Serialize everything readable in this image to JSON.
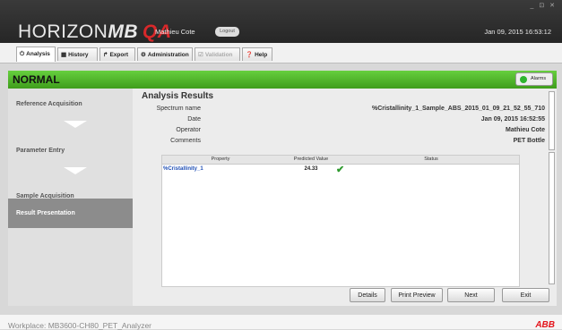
{
  "app": {
    "logo_horizon": "HORIZON",
    "logo_mb": "MB",
    "logo_qa": "QA",
    "user": "Mathieu Cote",
    "logout_label": "Logout",
    "datetime": "Jan 09, 2015 16:53:12",
    "window_controls": "_ ⊡ ✕"
  },
  "tabs": [
    {
      "label": "Analysis",
      "icon": "analysis-icon",
      "active": true
    },
    {
      "label": "History",
      "icon": "history-icon"
    },
    {
      "label": "Export",
      "icon": "export-icon"
    },
    {
      "label": "Administration",
      "icon": "administration-icon"
    },
    {
      "label": "Validation",
      "icon": "validation-icon",
      "disabled": true
    },
    {
      "label": "Help",
      "icon": "help-icon"
    }
  ],
  "status": {
    "text": "NORMAL",
    "color": "#4caf2b",
    "alarms_label": "Alarms"
  },
  "steps": [
    {
      "label": "Reference Acquisition"
    },
    {
      "label": "Parameter Entry"
    },
    {
      "label": "Sample Acquisition"
    },
    {
      "label": "Result Presentation",
      "active": true
    }
  ],
  "results": {
    "title": "Analysis Results",
    "fields": [
      {
        "label": "Spectrum name",
        "value": "%Cristallinity_1_Sample_ABS_2015_01_09_21_52_55_710"
      },
      {
        "label": "Date",
        "value": "Jan 09, 2015 16:52:55"
      },
      {
        "label": "Operator",
        "value": "Mathieu Cote"
      },
      {
        "label": "Comments",
        "value": "PET Bottle"
      }
    ]
  },
  "table": {
    "columns": [
      "Property",
      "Predicted Value",
      "Status"
    ],
    "rows": [
      {
        "property": "%Cristallinity_1",
        "predicted": "24.33",
        "status": "check-icon"
      }
    ]
  },
  "buttons": {
    "details": "Details",
    "print_preview": "Print Preview",
    "next": "Next",
    "exit": "Exit"
  },
  "footer": {
    "workplace": "Workplace:  MB3600-CH80_PET_Analyzer",
    "brand": "ABB"
  },
  "colors": {
    "status_green": "#4caf2b",
    "brand_red": "#e3141b",
    "link_blue": "#1f4fb5",
    "check_green": "#2e9a2e"
  }
}
